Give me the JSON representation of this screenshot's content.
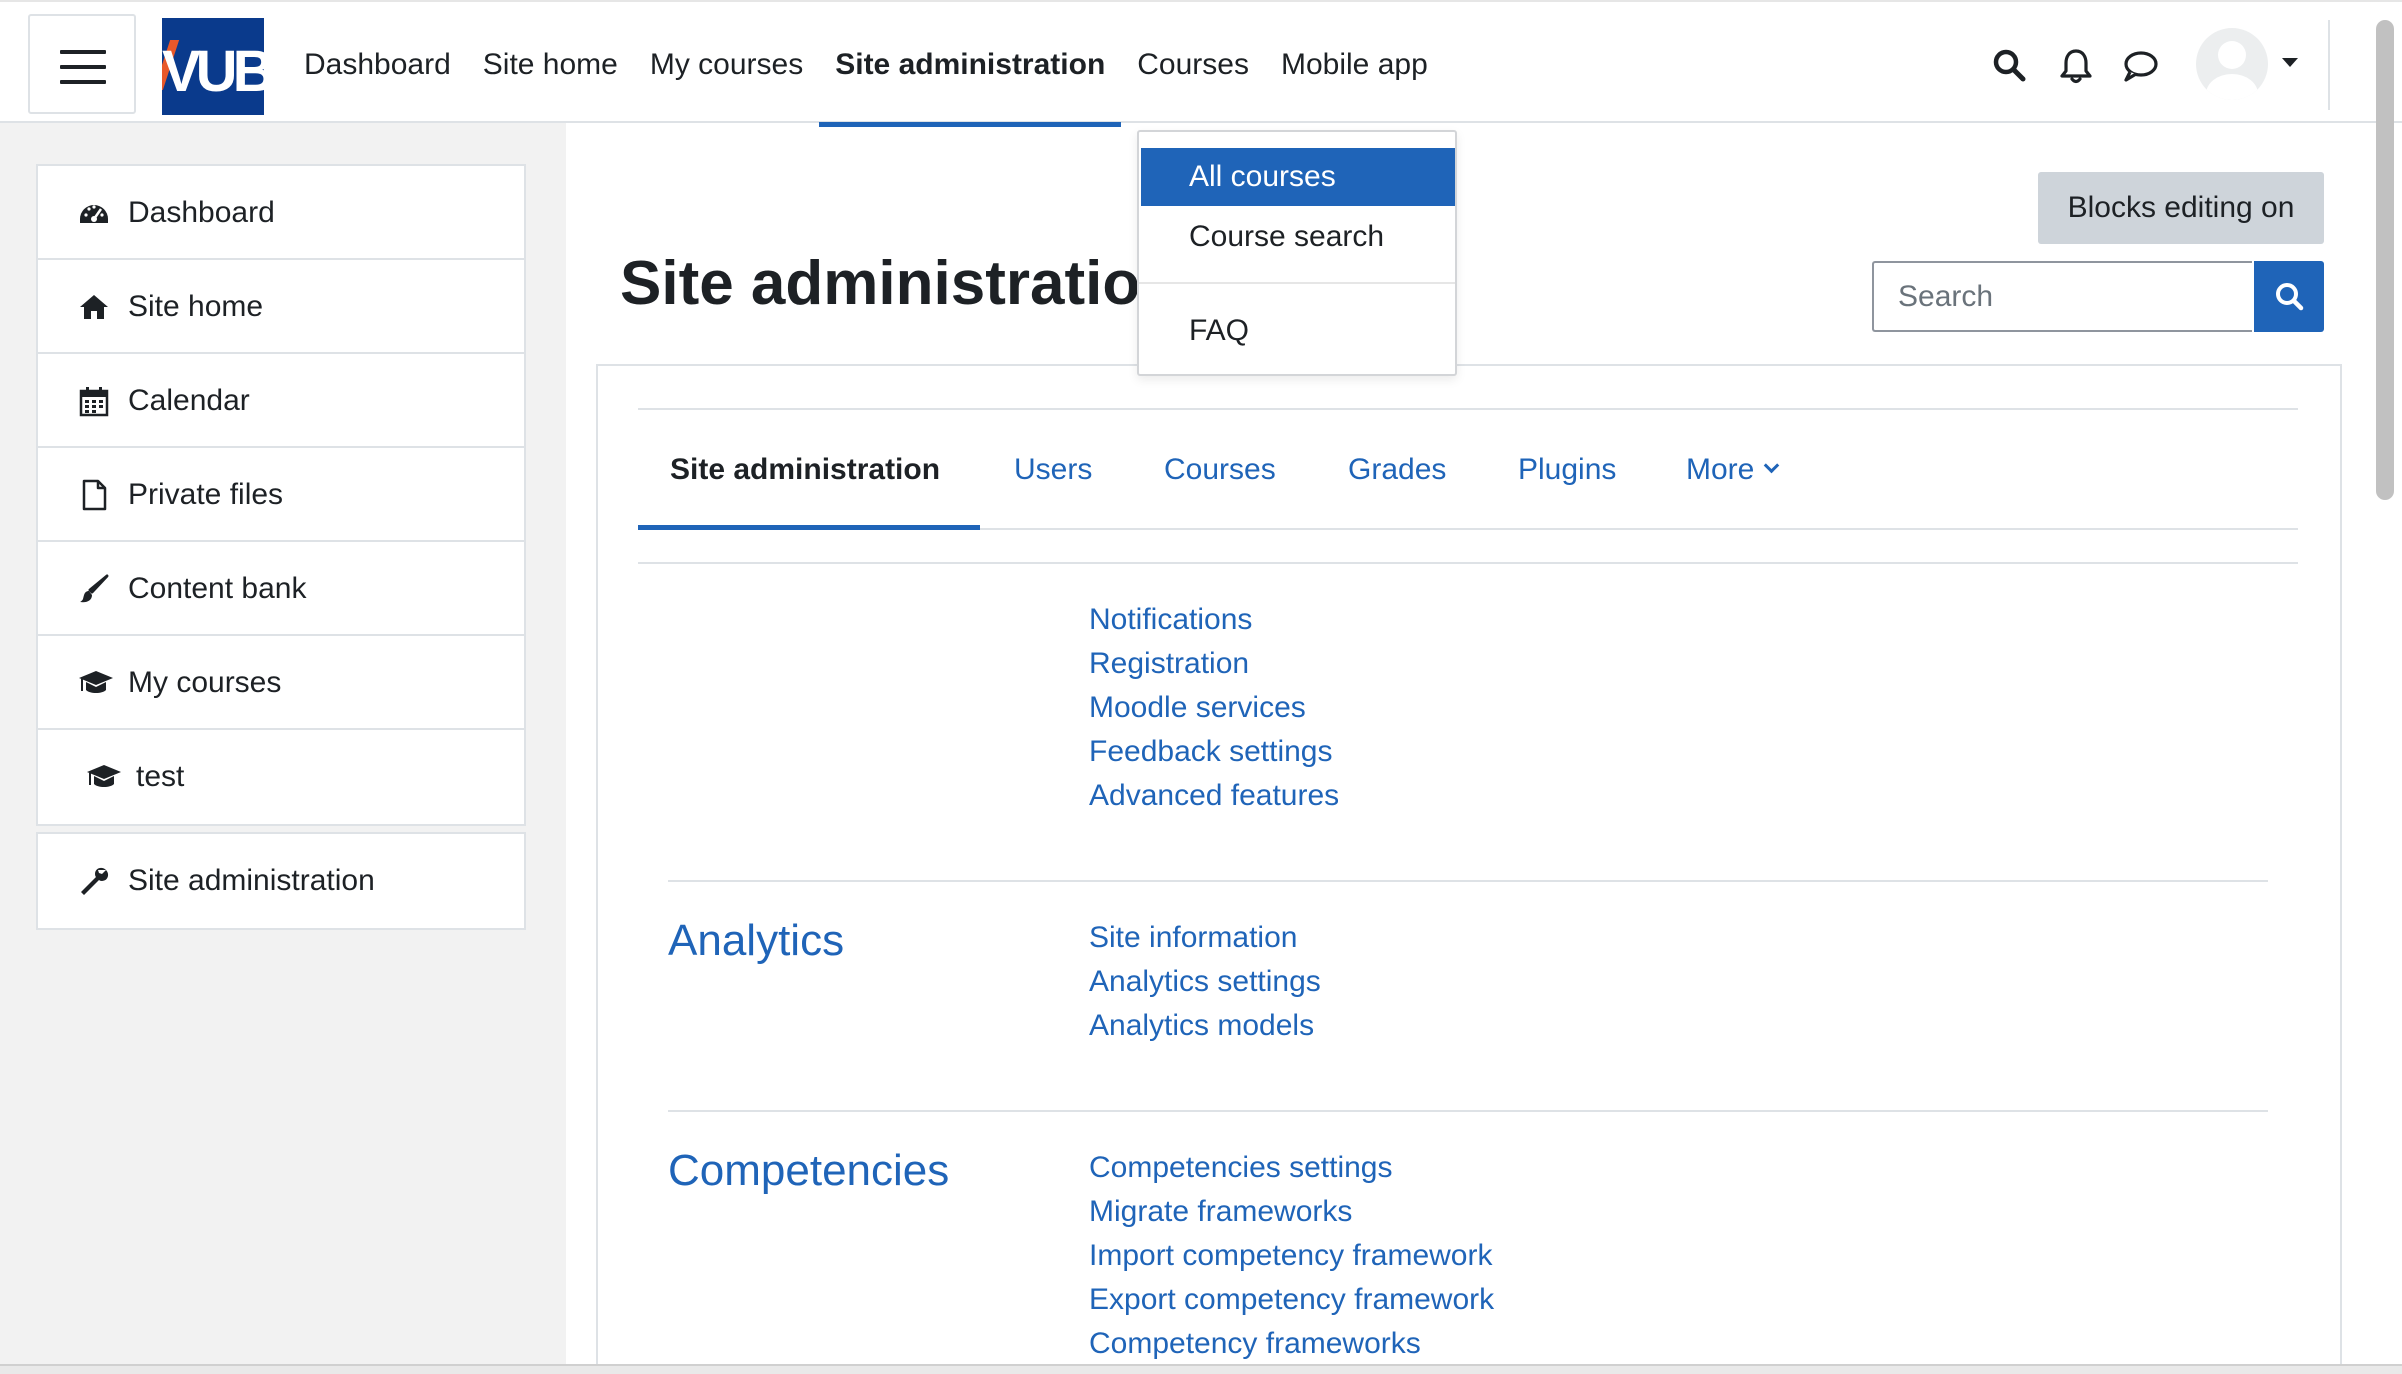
{
  "navbar": {
    "logo_text": "VUB",
    "items": [
      {
        "label": "Dashboard",
        "active": false
      },
      {
        "label": "Site home",
        "active": false
      },
      {
        "label": "My courses",
        "active": false
      },
      {
        "label": "Site administration",
        "active": true
      },
      {
        "label": "Courses",
        "active": false
      },
      {
        "label": "Mobile app",
        "active": false
      }
    ]
  },
  "courses_dropdown": {
    "items": [
      {
        "label": "All courses",
        "active": true
      },
      {
        "label": "Course search",
        "active": false
      },
      {
        "label": "FAQ",
        "active": false
      }
    ]
  },
  "drawer": {
    "items": [
      {
        "label": "Dashboard",
        "icon": "dashboard-icon"
      },
      {
        "label": "Site home",
        "icon": "home-icon"
      },
      {
        "label": "Calendar",
        "icon": "calendar-icon"
      },
      {
        "label": "Private files",
        "icon": "file-icon"
      },
      {
        "label": "Content bank",
        "icon": "paintbrush-icon"
      },
      {
        "label": "My courses",
        "icon": "graduation-cap-icon"
      },
      {
        "label": "test",
        "icon": "graduation-cap-icon"
      }
    ],
    "admin_item": {
      "label": "Site administration",
      "icon": "wrench-icon"
    }
  },
  "header": {
    "blocks_editing_label": "Blocks editing on",
    "page_title": "Site administration",
    "search_placeholder": "Search"
  },
  "tabs": [
    {
      "label": "Site administration",
      "active": true
    },
    {
      "label": "Users",
      "active": false
    },
    {
      "label": "Courses",
      "active": false
    },
    {
      "label": "Grades",
      "active": false
    },
    {
      "label": "Plugins",
      "active": false
    },
    {
      "label": "More",
      "active": false
    }
  ],
  "sections": [
    {
      "title": "",
      "links": [
        "Notifications",
        "Registration",
        "Moodle services",
        "Feedback settings",
        "Advanced features"
      ]
    },
    {
      "title": "Analytics",
      "links": [
        "Site information",
        "Analytics settings",
        "Analytics models"
      ]
    },
    {
      "title": "Competencies",
      "links": [
        "Competencies settings",
        "Migrate frameworks",
        "Import competency framework",
        "Export competency framework",
        "Competency frameworks"
      ]
    }
  ],
  "colors": {
    "accent": "#1f64b8",
    "logo_bg": "#0a3a8c",
    "drawer_bg": "#f2f2f2",
    "button_grey": "#ced4da"
  }
}
